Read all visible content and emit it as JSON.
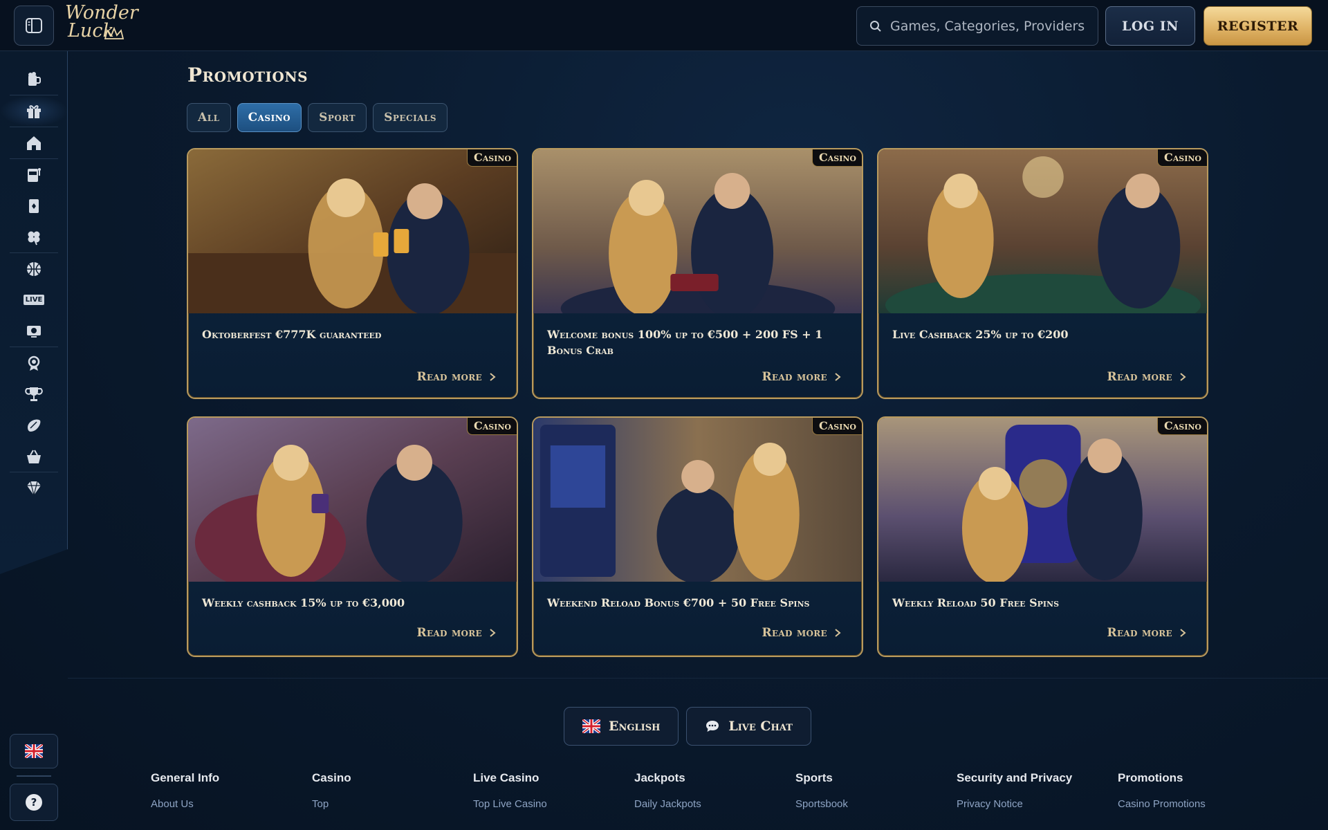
{
  "header": {
    "logo_line1": "Wonder",
    "logo_line2": "Luck",
    "search_placeholder": "Games, Categories, Providers",
    "login_label": "LOG IN",
    "register_label": "REGISTER"
  },
  "sidebar": {
    "items": [
      {
        "icon": "beer-icon"
      },
      {
        "icon": "gift-icon"
      },
      {
        "icon": "home-icon"
      },
      {
        "icon": "slot-machine-icon"
      },
      {
        "icon": "card-icon"
      },
      {
        "icon": "clover-icon"
      },
      {
        "icon": "basketball-icon"
      },
      {
        "icon": "live-icon",
        "label": "LIVE"
      },
      {
        "icon": "live-tv-icon"
      },
      {
        "icon": "gear-badge-icon"
      },
      {
        "icon": "trophy-icon"
      },
      {
        "icon": "rugby-ball-icon"
      },
      {
        "icon": "basket-icon"
      },
      {
        "icon": "diamond-icon"
      }
    ],
    "help_label": "?"
  },
  "main": {
    "title": "Promotions",
    "tabs": [
      {
        "label": "All",
        "active": false
      },
      {
        "label": "Casino",
        "active": true
      },
      {
        "label": "Sport",
        "active": false
      },
      {
        "label": "Specials",
        "active": false
      }
    ],
    "cards": [
      {
        "badge": "Casino",
        "title": "Oktoberfest €777K guaranteed",
        "read_more": "Read more"
      },
      {
        "badge": "Casino",
        "title": "Welcome bonus 100% up to €500 + 200 FS + 1 Bonus Crab",
        "read_more": "Read more"
      },
      {
        "badge": "Casino",
        "title": "Live Cashback 25% up to €200",
        "read_more": "Read more"
      },
      {
        "badge": "Casino",
        "title": "Weekly cashback 15% up to €3,000",
        "read_more": "Read more"
      },
      {
        "badge": "Casino",
        "title": "Weekend Reload Bonus €700 + 50 Free Spins",
        "read_more": "Read more"
      },
      {
        "badge": "Casino",
        "title": "Weekly Reload 50 Free Spins",
        "read_more": "Read more"
      }
    ]
  },
  "footer": {
    "language_label": "English",
    "live_chat_label": "Live Chat",
    "columns": [
      {
        "heading": "General Info",
        "links": [
          "About Us"
        ]
      },
      {
        "heading": "Casino",
        "links": [
          "Top"
        ]
      },
      {
        "heading": "Live Casino",
        "links": [
          "Top Live Casino"
        ]
      },
      {
        "heading": "Jackpots",
        "links": [
          "Daily Jackpots"
        ]
      },
      {
        "heading": "Sports",
        "links": [
          "Sportsbook"
        ]
      },
      {
        "heading": "Security and Privacy",
        "links": [
          "Privacy Notice"
        ]
      },
      {
        "heading": "Promotions",
        "links": [
          "Casino Promotions"
        ]
      }
    ]
  },
  "colors": {
    "accent_gold": "#e0b467",
    "active_tab_blue": "#2e6ea8",
    "background": "#0a1a2e"
  }
}
